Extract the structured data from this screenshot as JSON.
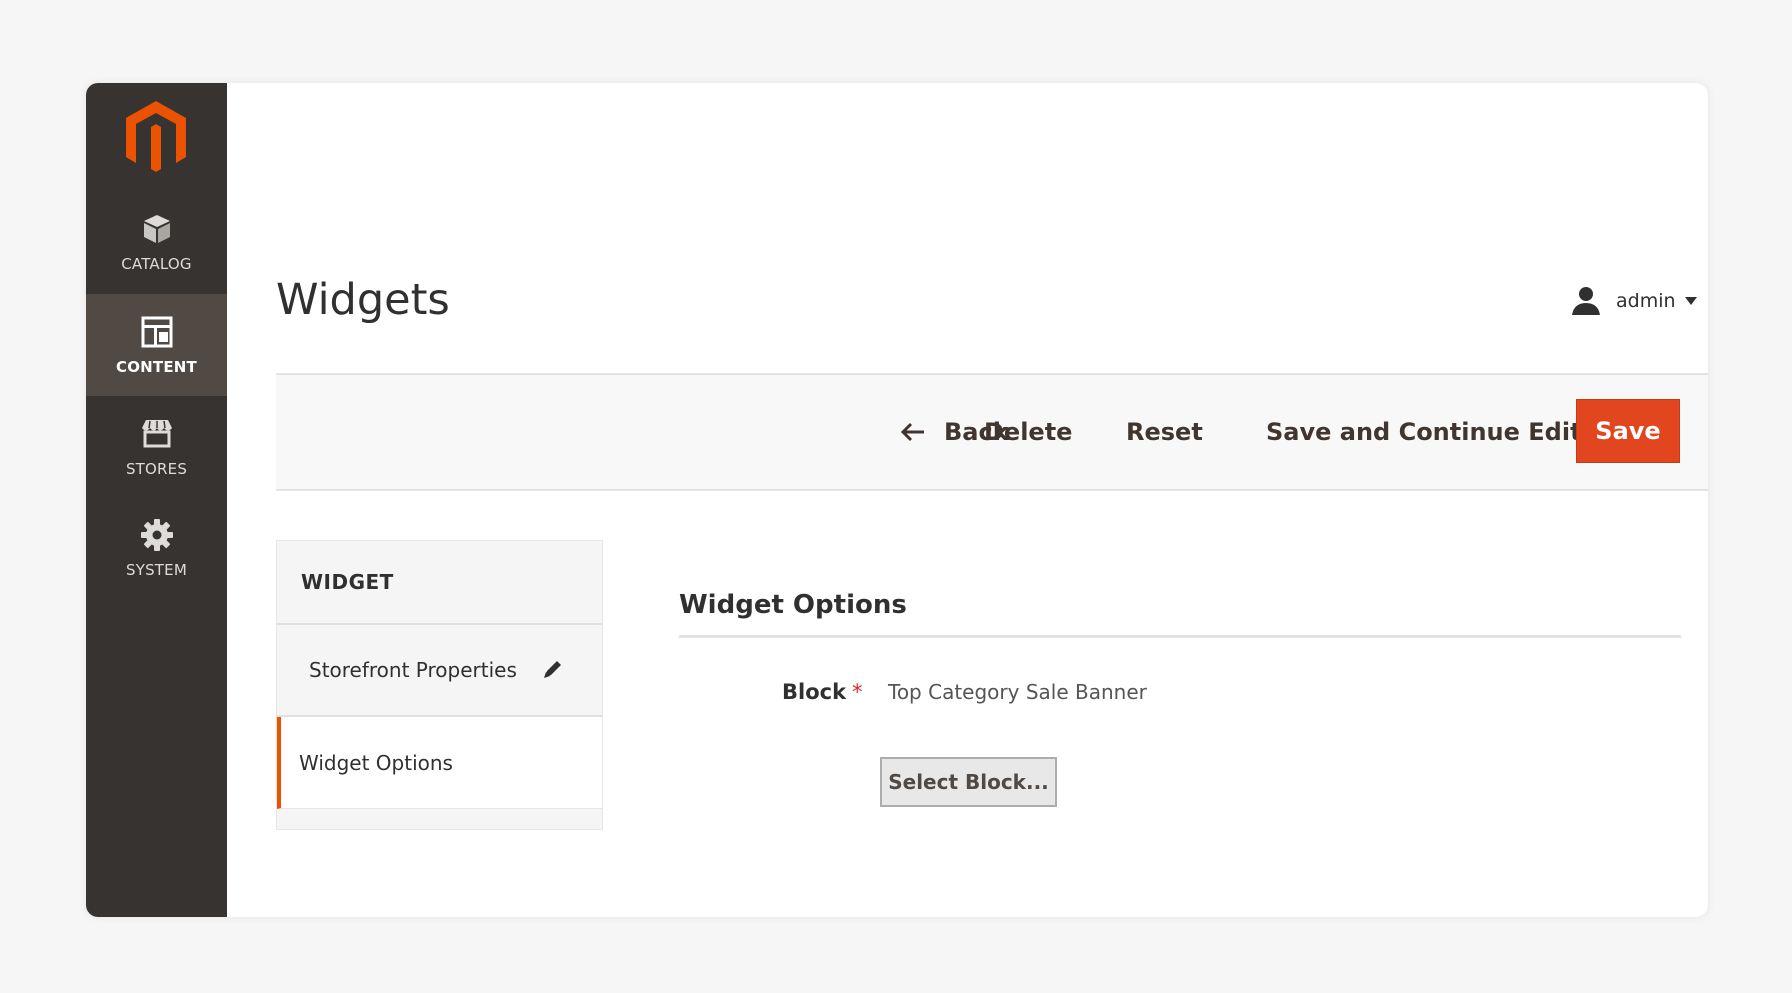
{
  "app": {
    "brand_color": "#eb5202",
    "logo_icon": "magento-logo-icon"
  },
  "sidebar": {
    "items": [
      {
        "label": "CATALOG",
        "icon": "cube-icon",
        "active": false
      },
      {
        "label": "CONTENT",
        "icon": "layout-icon",
        "active": true
      },
      {
        "label": "STORES",
        "icon": "storefront-icon",
        "active": false
      },
      {
        "label": "SYSTEM",
        "icon": "gear-icon",
        "active": false
      }
    ]
  },
  "header": {
    "title": "Widgets",
    "user": {
      "name": "admin",
      "icon": "user-icon"
    }
  },
  "toolbar": {
    "back_label": "Back",
    "delete_label": "Delete",
    "reset_label": "Reset",
    "save_continue_label": "Save and Continue Edit",
    "save_label": "Save",
    "save_color": "#e1461f"
  },
  "tabs": {
    "header": "WIDGET",
    "items": [
      {
        "label": "Storefront Properties",
        "active": false,
        "edited": true
      },
      {
        "label": "Widget Options",
        "active": true,
        "edited": false
      }
    ]
  },
  "widget_options": {
    "title": "Widget Options",
    "block_label": "Block",
    "required_mark": "*",
    "block_value": "Top Category Sale Banner",
    "select_button_label": "Select Block..."
  }
}
